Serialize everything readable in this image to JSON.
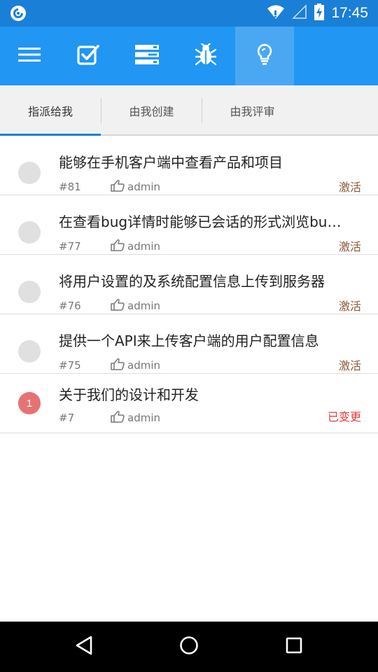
{
  "statusbar": {
    "time": "17:45"
  },
  "toolbar": {
    "buttons": [
      {
        "icon": "menu-icon"
      },
      {
        "icon": "checkbox-task-icon"
      },
      {
        "icon": "server-list-icon"
      },
      {
        "icon": "bug-icon"
      },
      {
        "icon": "lightbulb-story-icon",
        "active": true
      }
    ]
  },
  "tabs": [
    {
      "label": "指派给我",
      "active": true
    },
    {
      "label": "由我创建"
    },
    {
      "label": "由我评审"
    }
  ],
  "items": [
    {
      "title": "能够在手机客户端中查看产品和项目",
      "id": "#81",
      "user": "admin",
      "status": "激活",
      "badge": ""
    },
    {
      "title": "在查看bug详情时能够已会话的形式浏览bug历史",
      "id": "#77",
      "user": "admin",
      "status": "激活",
      "badge": ""
    },
    {
      "title": "将用户设置的及系统配置信息上传到服务器",
      "id": "#76",
      "user": "admin",
      "status": "激活",
      "badge": ""
    },
    {
      "title": "提供一个API来上传客户端的用户配置信息",
      "id": "#75",
      "user": "admin",
      "status": "激活",
      "badge": ""
    },
    {
      "title": "关于我们的设计和开发",
      "id": "#7",
      "user": "admin",
      "status": "已变更",
      "badge": "1"
    }
  ],
  "colors": {
    "statusbar": "#1a7fd6",
    "toolbar": "#2196f3",
    "status_active": "#8a5a3a",
    "status_changed": "#e53935",
    "badge_red": "#e57373"
  }
}
